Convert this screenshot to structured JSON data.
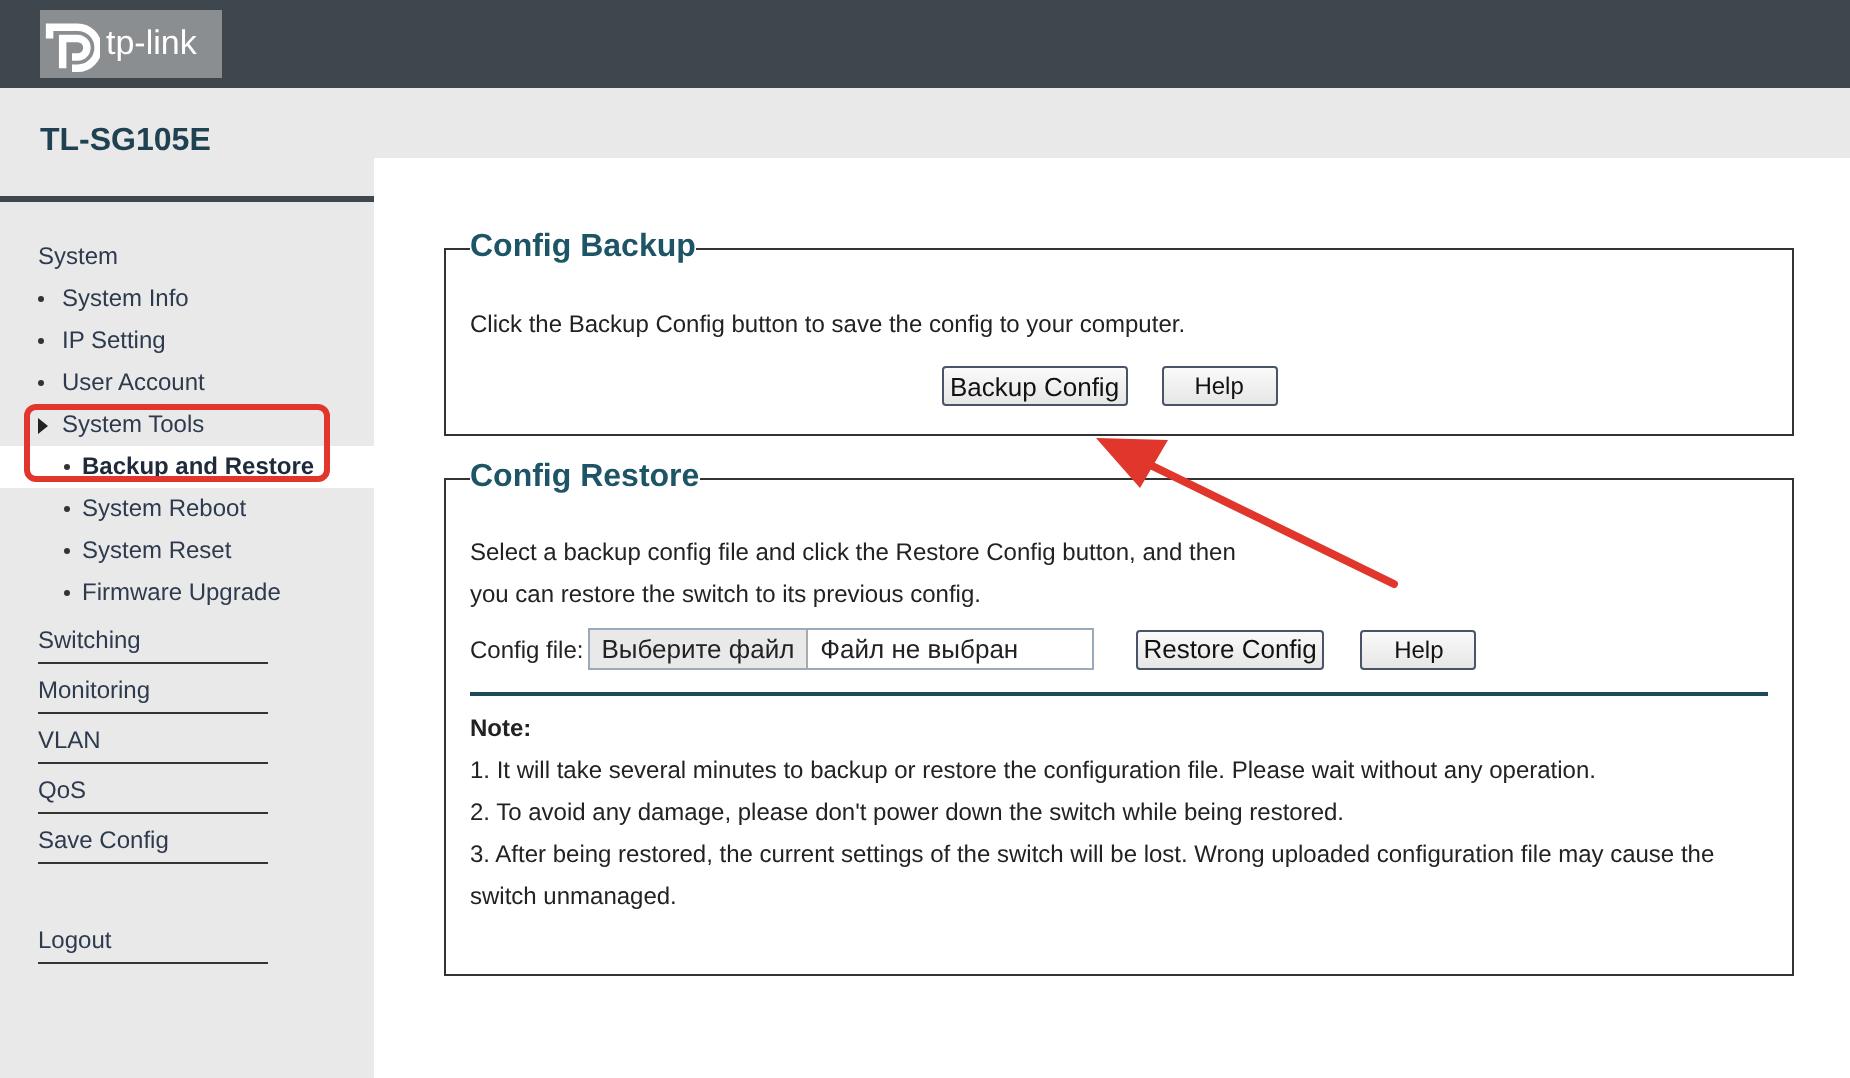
{
  "header": {
    "logo_text": "tp-link"
  },
  "device_model": "TL-SG105E",
  "sidebar": {
    "items": [
      {
        "label": "System",
        "kind": "heading",
        "children": [
          {
            "label": "System Info",
            "kind": "bullet",
            "selected": false
          },
          {
            "label": "IP Setting",
            "kind": "bullet",
            "selected": false
          },
          {
            "label": "User Account",
            "kind": "bullet",
            "selected": false
          },
          {
            "label": "System Tools",
            "kind": "folder",
            "expanded": true,
            "children": [
              {
                "label": "Backup and Restore",
                "selected": true
              },
              {
                "label": "System Reboot",
                "selected": false
              },
              {
                "label": "System Reset",
                "selected": false
              },
              {
                "label": "Firmware Upgrade",
                "selected": false
              }
            ]
          }
        ]
      },
      {
        "label": "Switching",
        "kind": "link"
      },
      {
        "label": "Monitoring",
        "kind": "link"
      },
      {
        "label": "VLAN",
        "kind": "link"
      },
      {
        "label": "QoS",
        "kind": "link"
      },
      {
        "label": "Save Config",
        "kind": "link"
      },
      {
        "label": "Logout",
        "kind": "logout"
      }
    ]
  },
  "backup": {
    "title": "Config Backup",
    "text": "Click the Backup Config button to save the config to your computer.",
    "buttons": [
      "Backup Config",
      "Help"
    ]
  },
  "restore": {
    "title": "Config Restore",
    "text_lines": [
      "Select a backup config file and click the Restore Config button, and then",
      "you can restore the switch to its previous config."
    ],
    "file_label": "Config file:",
    "file_button": "Выберите файл",
    "file_status": "Файл не выбран",
    "buttons": [
      "Restore Config",
      "Help"
    ],
    "note_title": "Note:",
    "notes": [
      "1. It will take several minutes to backup or restore the configuration file. Please wait without any operation.",
      "2. To avoid any damage, please don't power down the switch while being restored.",
      "3. After being restored, the current settings of the switch will be lost. Wrong uploaded configuration file may cause the switch unmanaged."
    ]
  }
}
